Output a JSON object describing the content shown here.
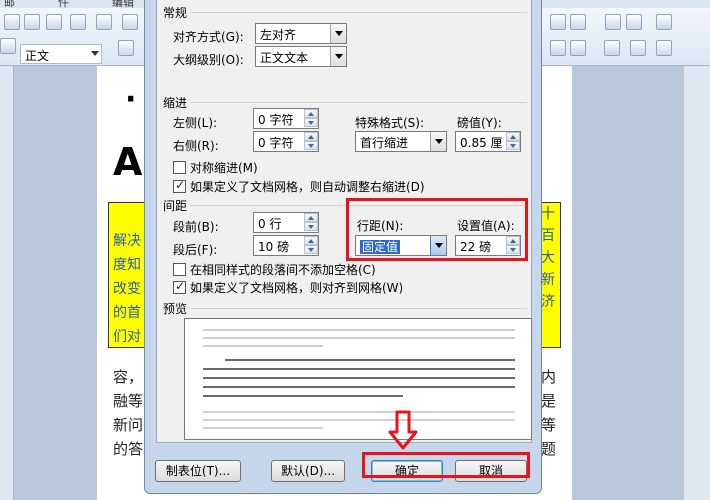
{
  "background": {
    "menu": [
      "邮",
      "件",
      "编辑"
    ],
    "style_box": "正文",
    "title_top": "·",
    "title_letter": "A",
    "highlight_left": [
      "解决",
      "度知",
      "改变",
      "的首",
      "们对"
    ],
    "highlight_right": [
      "十",
      "百",
      "大",
      "新",
      "济"
    ],
    "body_left": [
      "容，",
      "融等",
      "新问",
      "的答"
    ],
    "body_right": [
      "内",
      "是",
      "等",
      "题"
    ]
  },
  "dialog": {
    "general": {
      "section": "常规",
      "alignment_label": "对齐方式(G):",
      "alignment_value": "左对齐",
      "outline_label": "大纲级别(O):",
      "outline_value": "正文文本"
    },
    "indent": {
      "section": "缩进",
      "left_label": "左侧(L):",
      "left_value": "0 字符",
      "right_label": "右侧(R):",
      "right_value": "0 字符",
      "special_label": "特殊格式(S):",
      "special_value": "首行缩进",
      "by_label": "磅值(Y):",
      "by_value": "0.85 厘",
      "mirror_label": "对称缩进(M)",
      "auto_adjust_label": "如果定义了文档网格，则自动调整右缩进(D)"
    },
    "spacing": {
      "section": "间距",
      "before_label": "段前(B):",
      "before_value": "0 行",
      "after_label": "段后(F):",
      "after_value": "10 磅",
      "line_spacing_label": "行距(N):",
      "line_spacing_value": "固定值",
      "at_label": "设置值(A):",
      "at_value": "22 磅",
      "no_space_label": "在相同样式的段落间不添加空格(C)",
      "snap_grid_label": "如果定义了文档网格，则对齐到网格(W)"
    },
    "preview": {
      "section": "预览"
    },
    "buttons": {
      "tabs": "制表位(T)...",
      "default": "默认(D)...",
      "ok": "确定",
      "cancel": "取消"
    }
  },
  "colors": {
    "annotation_red": "#e8141b",
    "highlight_yellow": "#ffff00",
    "focus_blue": "#3169c6"
  }
}
